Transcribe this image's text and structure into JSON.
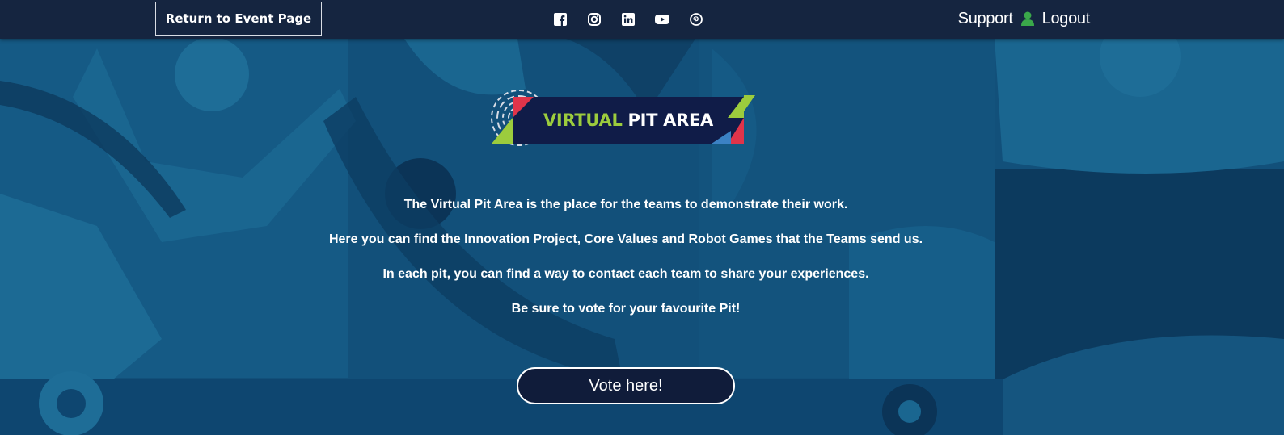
{
  "topbar": {
    "return_label": "Return to Event Page",
    "social": [
      {
        "icon": "facebook-icon"
      },
      {
        "icon": "instagram-icon"
      },
      {
        "icon": "linkedin-icon"
      },
      {
        "icon": "youtube-icon"
      },
      {
        "icon": "pinterest-icon"
      }
    ],
    "support_label": "Support",
    "user_icon": "user-icon",
    "user_icon_color": "#3aa84a",
    "logout_label": "Logout"
  },
  "logo": {
    "word1": "VIRTUAL",
    "word2": "PIT AREA",
    "accent_green": "#9ccc3d",
    "accent_red": "#e0344a",
    "accent_blue": "#3b82c4"
  },
  "intro": {
    "lines": [
      "The Virtual Pit Area is the place for the teams to demonstrate their work.",
      "Here you can find the Innovation Project, Core Values and Robot Games that the Teams send us.",
      "In each pit, you can find a way to contact each team to share your experiences.",
      "Be sure to vote for your favourite Pit!"
    ]
  },
  "vote": {
    "label": "Vote here!"
  },
  "colors": {
    "topbar": "#152540",
    "background": "#0f4a6e",
    "button_dark": "#101c3a"
  }
}
